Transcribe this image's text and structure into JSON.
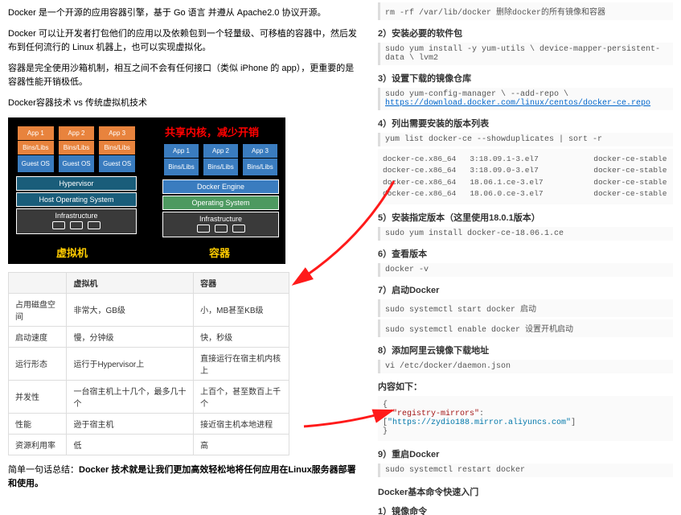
{
  "left": {
    "p1": "Docker 是一个开源的应用容器引擎，基于 Go 语言 并遵从 Apache2.0 协议开源。",
    "p2": "Docker 可以让开发者打包他们的应用以及依赖包到一个轻量级、可移植的容器中，然后发布到任何流行的 Linux 机器上，也可以实现虚拟化。",
    "p3": "容器是完全使用沙箱机制，相互之间不会有任何接口（类似 iPhone 的 app），更重要的是容器性能开销极低。",
    "heading": "Docker容器技术 vs 传统虚拟机技术",
    "diagram": {
      "title": "共享内核，减少开销",
      "app1": "App 1",
      "app2": "App 2",
      "app3": "App 3",
      "bins": "Bins/Libs",
      "guest": "Guest OS",
      "hyp": "Hypervisor",
      "host": "Host Operating System",
      "infra": "Infrastructure",
      "engine": "Docker Engine",
      "os": "Operating System",
      "vm_label": "虚拟机",
      "ct_label": "容器"
    },
    "table": {
      "h1": "",
      "h2": "虚拟机",
      "h3": "容器",
      "rows": [
        {
          "c1": "占用磁盘空间",
          "c2": "非常大，GB级",
          "c3": "小，MB甚至KB级"
        },
        {
          "c1": "启动速度",
          "c2": "慢，分钟级",
          "c3": "快，秒级"
        },
        {
          "c1": "运行形态",
          "c2": "运行于Hypervisor上",
          "c3": "直接运行在宿主机内核上"
        },
        {
          "c1": "并发性",
          "c2": "一台宿主机上十几个，最多几十个",
          "c3": "上百个，甚至数百上千个"
        },
        {
          "c1": "性能",
          "c2": "逊于宿主机",
          "c3": "接近宿主机本地进程"
        },
        {
          "c1": "资源利用率",
          "c2": "低",
          "c3": "高"
        }
      ]
    },
    "summary_prefix": "简单一句话总结：",
    "summary": "Docker 技术就是让我们更加高效轻松地将任何应用在Linux服务器部署和使用。"
  },
  "right": {
    "cmd0": "rm -rf /var/lib/docker 删除docker的所有镜像和容器",
    "h2": "2）安装必要的软件包",
    "cmd2": "sudo yum install -y yum-utils \\ device-mapper-persistent-data \\ lvm2",
    "h3": "3）设置下载的镜像仓库",
    "cmd3a": "sudo yum-config-manager \\ --add-repo \\ ",
    "cmd3_link_text": "https://download.docker.com/linux/centos/docker-ce.repo",
    "h4": "4）列出需要安装的版本列表",
    "cmd4": "yum list docker-ce --showduplicates | sort -r",
    "versions": "docker-ce.x86_64   3:18.09.1-3.el7            docker-ce-stable\ndocker-ce.x86_64   3:18.09.0-3.el7            docker-ce-stable\ndocker-ce.x86_64   18.06.1.ce-3.el7           docker-ce-stable\ndocker-ce.x86_64   18.06.0.ce-3.el7           docker-ce-stable",
    "h5": "5）安装指定版本（这里使用18.0.1版本）",
    "cmd5": "sudo yum install docker-ce-18.06.1.ce",
    "h6": "6）查看版本",
    "cmd6": "docker -v",
    "h7": "7）启动Docker",
    "cmd7a": "sudo systemctl start docker 启动",
    "cmd7b": "sudo systemctl enable docker 设置开机启动",
    "h8": "8）添加阿里云镜像下载地址",
    "cmd8": "vi /etc/docker/daemon.json",
    "h8b": "内容如下：",
    "json_open": "{",
    "json_key": "\"registry-mirrors\"",
    "json_colon": ": [",
    "json_val": "\"https://zydio188.mirror.aliyuncs.com\"",
    "json_close": "]",
    "json_end": "}",
    "h9": "9）重启Docker",
    "cmd9": "sudo systemctl restart docker",
    "section2": "Docker基本命令快速入门",
    "h10": "1）镜像命令"
  }
}
